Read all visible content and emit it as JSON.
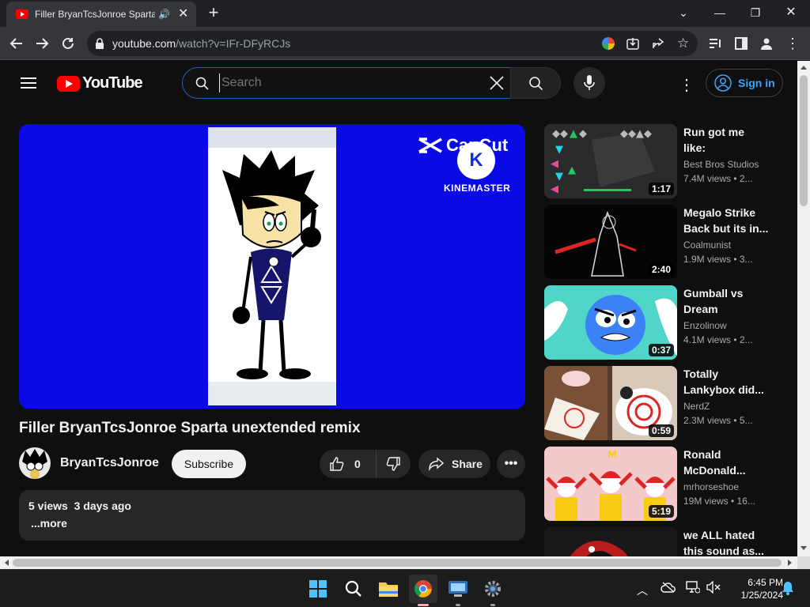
{
  "browser": {
    "tab_title": "Filler BryanTcsJonroe Sparta",
    "tab_close": "✕",
    "new_tab": "+",
    "url_host": "youtube.com",
    "url_path": "/watch?v=IFr-DFyRCJs"
  },
  "youtube": {
    "logo_text": "YouTube",
    "search_placeholder": "Search",
    "sign_in": "Sign in"
  },
  "video": {
    "title": "Filler BryanTcsJonroe Sparta unextended remix",
    "channel": "BryanTcsJonroe",
    "subscribe": "Subscribe",
    "likes": "0",
    "share": "Share",
    "stats": "5 views  3 days ago",
    "more": "...more",
    "overlay_capcut": "CapCut",
    "overlay_k": "K",
    "overlay_kinemaster": "KINEMASTER"
  },
  "suggestions": [
    {
      "title": "Run got me like:",
      "channel": "Best Bros Studios",
      "meta": "7.4M views  • 2...",
      "duration": "1:17",
      "color": "#2a2a2a"
    },
    {
      "title": "Megalo Strike Back but its in...",
      "channel": "Coalmunist",
      "meta": "1.9M views  • 3...",
      "duration": "2:40",
      "color": "#050505"
    },
    {
      "title": "Gumball vs Dream",
      "channel": "Enzolinow",
      "meta": "4.1M views  • 2...",
      "duration": "0:37",
      "color": "#4fd6c8"
    },
    {
      "title": "Totally Lankybox did...",
      "channel": "NerdZ",
      "meta": "2.3M views  • 5...",
      "duration": "0:59",
      "color": "#5a3a2a"
    },
    {
      "title": "Ronald McDonald...",
      "channel": "mrhorseshoe",
      "meta": "19M views  • 16...",
      "duration": "5:19",
      "color": "#f3c9c9"
    },
    {
      "title": "we ALL hated this sound as...",
      "channel": "",
      "meta": "",
      "duration": "",
      "color": "#181818"
    }
  ],
  "taskbar": {
    "time": "6:45 PM",
    "date": "1/25/2024"
  }
}
